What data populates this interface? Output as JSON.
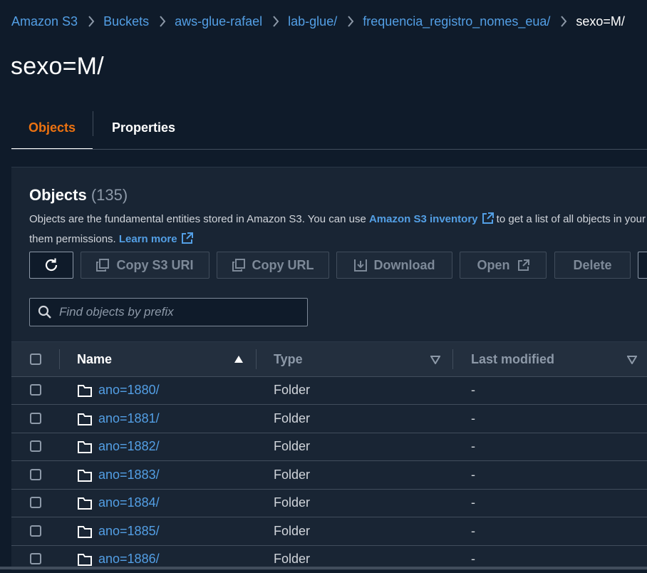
{
  "breadcrumb": {
    "items": [
      "Amazon S3",
      "Buckets",
      "aws-glue-rafael",
      "lab-glue/",
      "frequencia_registro_nomes_eua/"
    ],
    "current": "sexo=M/"
  },
  "page_title": "sexo=M/",
  "tabs": [
    {
      "label": "Objects",
      "active": true
    },
    {
      "label": "Properties",
      "active": false
    }
  ],
  "objects_panel": {
    "title": "Objects",
    "count": "(135)",
    "description": {
      "line1_prefix": "Objects are the fundamental entities stored in Amazon S3. You can use ",
      "inventory_link": "Amazon S3 inventory",
      "line1_suffix": " to get a list of all objects in your bucket. For others to access your objects, you'll need to explicitly grant",
      "line2_prefix": "them permissions. ",
      "learn_more_link": "Learn more"
    }
  },
  "toolbar": {
    "refresh_icon": "refresh-icon",
    "copy_s3_uri": "Copy S3 URI",
    "copy_url": "Copy URL",
    "download": "Download",
    "open": "Open",
    "delete": "Delete"
  },
  "search": {
    "placeholder": "Find objects by prefix",
    "value": ""
  },
  "table": {
    "columns": {
      "name": "Name",
      "type": "Type",
      "last_modified": "Last modified"
    },
    "sort": {
      "column": "Name",
      "direction": "ascending"
    },
    "rows": [
      {
        "name": "ano=1880/",
        "type": "Folder",
        "last_modified": "-"
      },
      {
        "name": "ano=1881/",
        "type": "Folder",
        "last_modified": "-"
      },
      {
        "name": "ano=1882/",
        "type": "Folder",
        "last_modified": "-"
      },
      {
        "name": "ano=1883/",
        "type": "Folder",
        "last_modified": "-"
      },
      {
        "name": "ano=1884/",
        "type": "Folder",
        "last_modified": "-"
      },
      {
        "name": "ano=1885/",
        "type": "Folder",
        "last_modified": "-"
      },
      {
        "name": "ano=1886/",
        "type": "Folder",
        "last_modified": "-"
      }
    ]
  },
  "colors": {
    "background": "#0f1b2a",
    "panel": "#192534",
    "link": "#539fe5",
    "active_tab": "#ec7211",
    "border": "#414d5c",
    "disabled_text": "#7d8998"
  }
}
